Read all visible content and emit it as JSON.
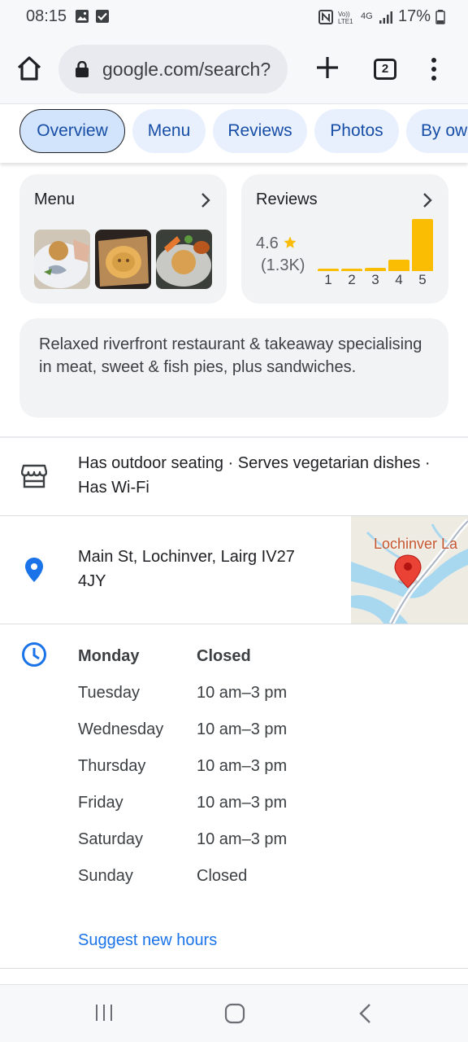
{
  "status_bar": {
    "time": "08:15",
    "network": "4G",
    "battery": "17%"
  },
  "browser": {
    "url": "google.com/search?",
    "tab_count": "2"
  },
  "chips": [
    {
      "label": "Overview",
      "active": true
    },
    {
      "label": "Menu"
    },
    {
      "label": "Reviews"
    },
    {
      "label": "Photos"
    },
    {
      "label": "By ow"
    }
  ],
  "menu_card": {
    "title": "Menu"
  },
  "reviews_card": {
    "title": "Reviews",
    "rating": "4.6",
    "count": "(1.3K)",
    "distribution": [
      {
        "star": "1",
        "fraction": 0.03
      },
      {
        "star": "2",
        "fraction": 0.03
      },
      {
        "star": "3",
        "fraction": 0.07
      },
      {
        "star": "4",
        "fraction": 0.22
      },
      {
        "star": "5",
        "fraction": 1.0
      }
    ]
  },
  "description": "Relaxed riverfront restaurant & takeaway specialising in meat, sweet & fish pies, plus sandwiches.",
  "amenities": "Has outdoor seating · Serves vegetarian dishes · Has Wi-Fi",
  "address": "Main St, Lochinver, Lairg IV27 4JY",
  "map_label": "Lochinver La",
  "hours": [
    {
      "day": "Monday",
      "time": "Closed",
      "today": true
    },
    {
      "day": "Tuesday",
      "time": "10 am–3 pm"
    },
    {
      "day": "Wednesday",
      "time": "10 am–3 pm"
    },
    {
      "day": "Thursday",
      "time": "10 am–3 pm"
    },
    {
      "day": "Friday",
      "time": "10 am–3 pm"
    },
    {
      "day": "Saturday",
      "time": "10 am–3 pm"
    },
    {
      "day": "Sunday",
      "time": "Closed"
    }
  ],
  "suggest_hours": "Suggest new hours",
  "colors": {
    "accent_blue": "#1a73e8",
    "star_yellow": "#fbbc04",
    "map_pin_red": "#ea4335"
  }
}
